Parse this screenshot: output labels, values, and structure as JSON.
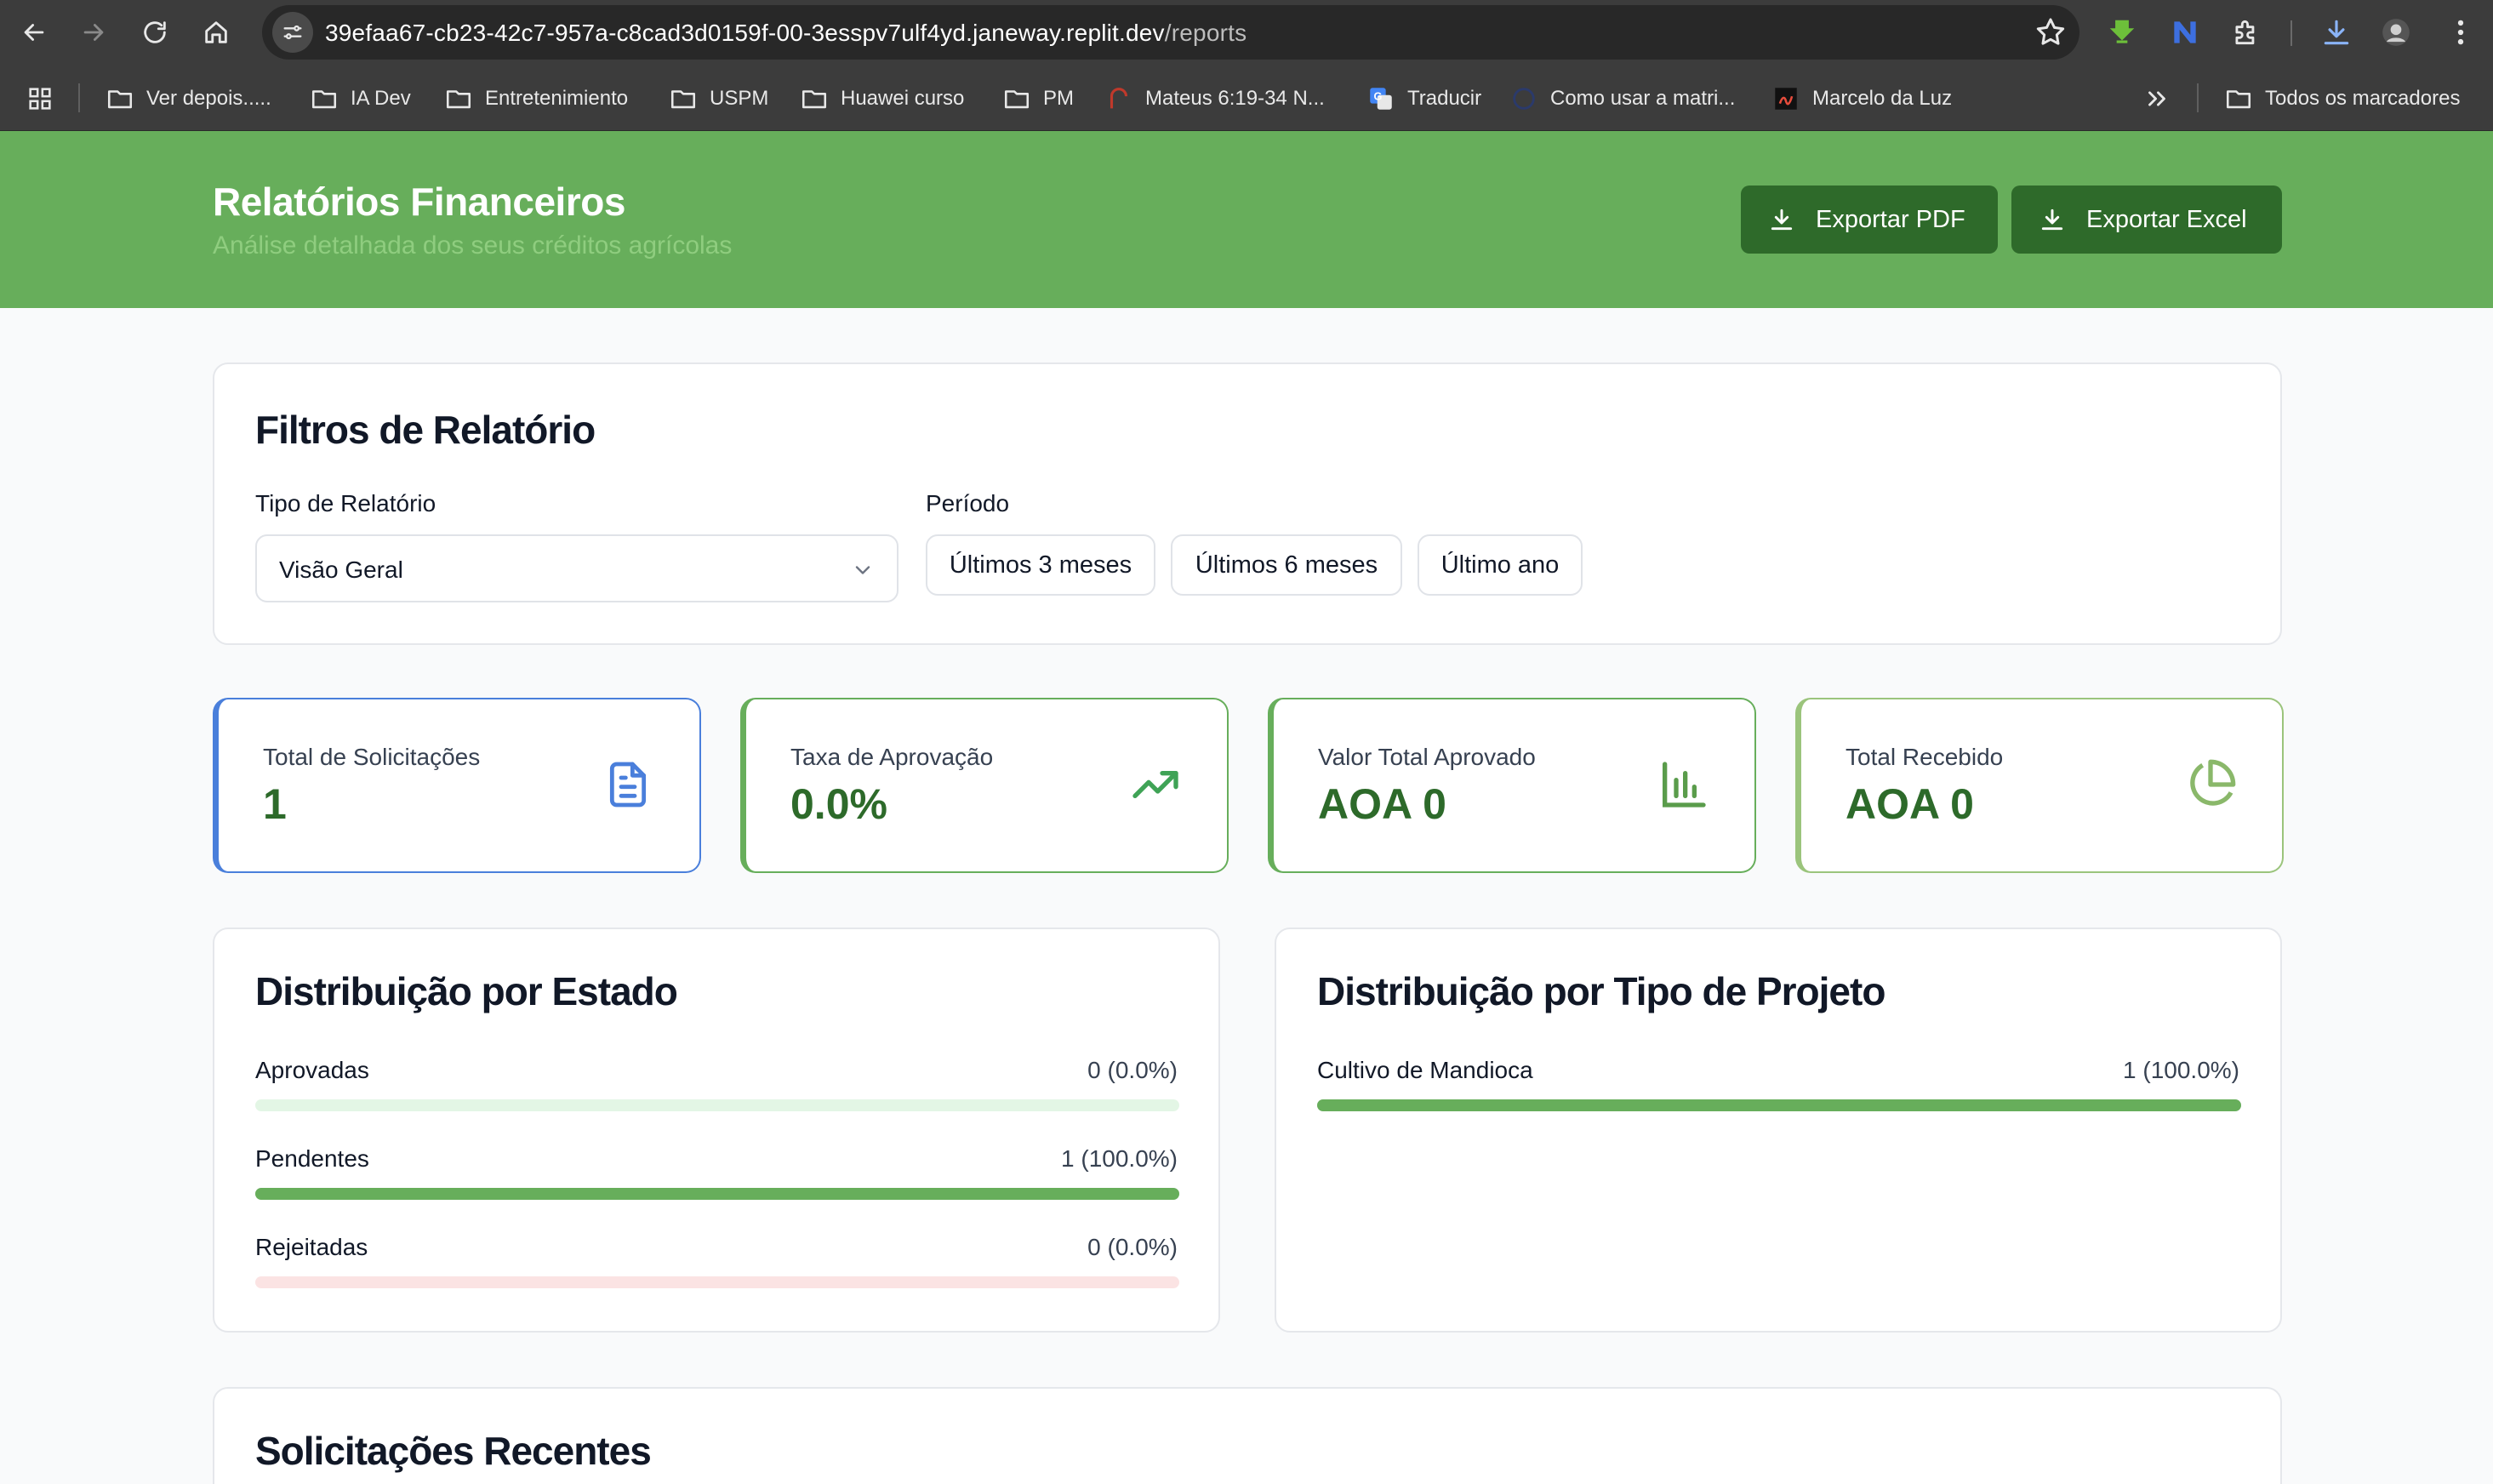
{
  "browser": {
    "url_host": "39efaa67-cb23-42c7-957a-c8cad3d0159f-00-3esspv7ulf4yd.janeway.replit.dev",
    "url_path": "/reports",
    "bookmarks": [
      {
        "label": "Ver depois.....",
        "icon": "folder-icon"
      },
      {
        "label": "IA Dev",
        "icon": "folder-icon"
      },
      {
        "label": "Entretenimiento",
        "icon": "folder-icon"
      },
      {
        "label": "USPM",
        "icon": "folder-icon"
      },
      {
        "label": "Huawei curso",
        "icon": "folder-icon"
      },
      {
        "label": "PM",
        "icon": "folder-icon"
      },
      {
        "label": "Mateus 6:19-34 N...",
        "icon": "bible-site-icon"
      },
      {
        "label": "Traducir",
        "icon": "google-translate-icon"
      },
      {
        "label": "Como usar a matri...",
        "icon": "site-icon"
      },
      {
        "label": "Marcelo da Luz",
        "icon": "video-site-icon"
      }
    ],
    "all_bookmarks_label": "Todos os marcadores"
  },
  "header": {
    "title": "Relatórios Financeiros",
    "subtitle": "Análise detalhada dos seus créditos agrícolas",
    "export_pdf": "Exportar PDF",
    "export_excel": "Exportar Excel",
    "background_color": "#67ae5b"
  },
  "filters": {
    "title": "Filtros de Relatório",
    "report_type_label": "Tipo de Relatório",
    "report_type_value": "Visão Geral",
    "period_label": "Período",
    "periods": [
      "Últimos 3 meses",
      "Últimos 6 meses",
      "Último ano"
    ]
  },
  "stats": [
    {
      "label": "Total de Solicitações",
      "value": "1",
      "icon": "document-icon",
      "accent": "#4a7fdb"
    },
    {
      "label": "Taxa de Aprovação",
      "value": "0.0%",
      "icon": "trending-up-icon",
      "accent": "#67ae5b"
    },
    {
      "label": "Valor Total Aprovado",
      "value": "AOA 0",
      "icon": "bar-chart-icon",
      "accent": "#67ae5b"
    },
    {
      "label": "Total Recebido",
      "value": "AOA 0",
      "icon": "pie-chart-icon",
      "accent": "#9bc47c"
    }
  ],
  "status_distribution": {
    "title": "Distribuição por Estado",
    "rows": [
      {
        "label": "Aprovadas",
        "value": "0 (0.0%)",
        "fraction": 0.0,
        "track_color": "#e3f6e5"
      },
      {
        "label": "Pendentes",
        "value": "1 (100.0%)",
        "fraction": 1.0,
        "track_color": "#e5e7eb"
      },
      {
        "label": "Rejeitadas",
        "value": "0 (0.0%)",
        "fraction": 0.0,
        "track_color": "#fbe3e3"
      }
    ]
  },
  "project_distribution": {
    "title": "Distribuição por Tipo de Projeto",
    "rows": [
      {
        "label": "Cultivo de Mandioca",
        "value": "1 (100.0%)",
        "fraction": 1.0,
        "track_color": "#e5e7eb"
      }
    ]
  },
  "recent": {
    "title": "Solicitações Recentes"
  }
}
